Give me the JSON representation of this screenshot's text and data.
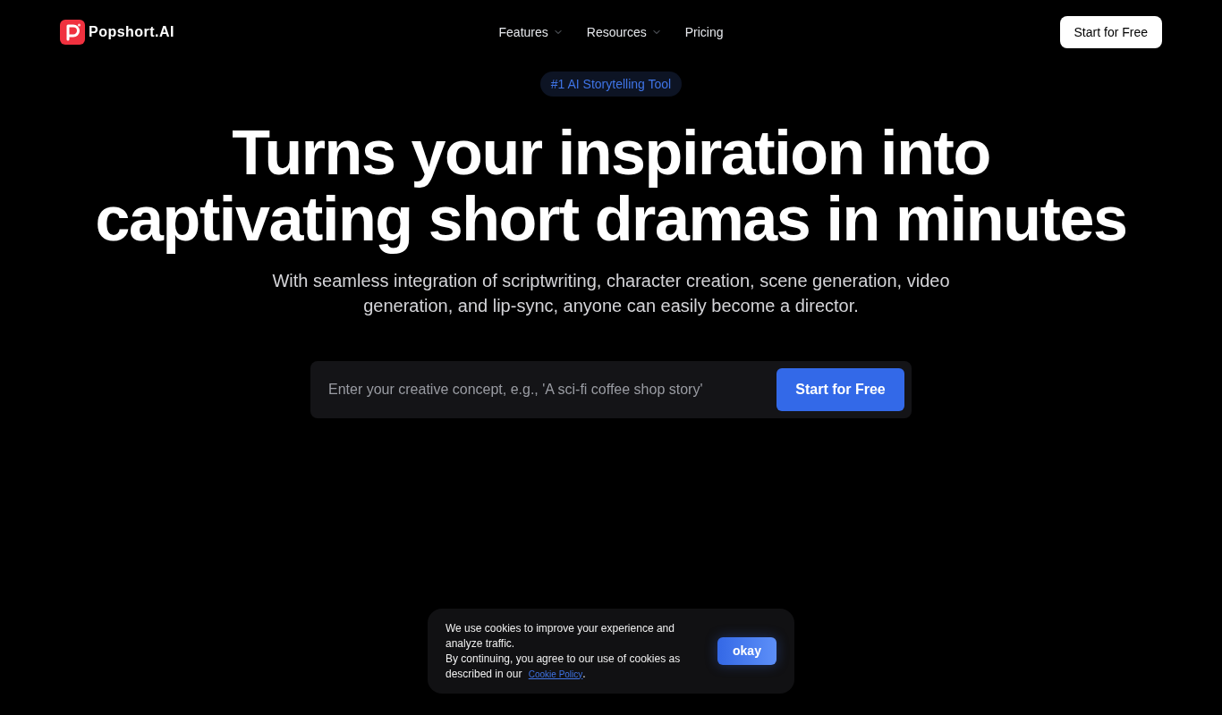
{
  "nav": {
    "logo": "Popshort.AI",
    "links": [
      {
        "label": "Features",
        "has_menu": true
      },
      {
        "label": "Resources",
        "has_menu": true
      },
      {
        "label": "Pricing",
        "has_menu": false
      }
    ],
    "cta": "Start for Free"
  },
  "hero": {
    "badge": "#1 AI Storytelling Tool",
    "title_lines": [
      "Turns your inspiration into",
      "captivating short dramas in minutes"
    ],
    "subtitle": "With seamless integration of scriptwriting, character creation, scene generation, video generation, and lip-sync, anyone can easily become a director.",
    "prompt": {
      "placeholder": "Enter your creative concept, e.g., 'A sci-fi coffee shop story'",
      "button": "Start for Free"
    }
  },
  "cookie_banner": {
    "paragraphs": [
      "We use cookies to improve your experience and analyze traffic.",
      "By continuing, you agree to our use of cookies as described in our"
    ],
    "link": "Cookie Policy",
    "after_link": ".",
    "button": "okay"
  }
}
